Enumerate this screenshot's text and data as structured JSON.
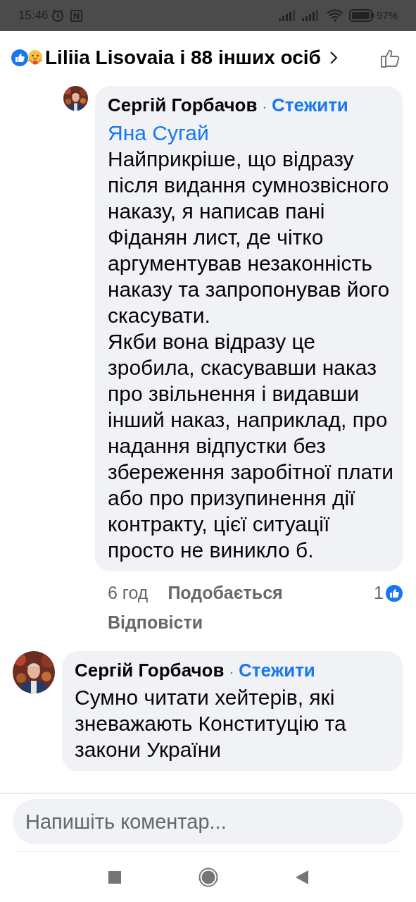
{
  "status_bar": {
    "time": "15:46",
    "battery": "97%"
  },
  "header": {
    "reactions": [
      {
        "kind": "like"
      },
      {
        "kind": "care"
      }
    ],
    "title": "Liliia Lisovaia і 88 інших осіб"
  },
  "comments": [
    {
      "kind": "reply",
      "author": "Сергій Горбачов",
      "separator": "·",
      "follow": "Стежити",
      "mention": "Яна Сугай",
      "paragraphs": [
        "Найприкріше, що відразу після видання сумнозвісного наказу, я написав пані Фіданян лист, де чітко аргументував незаконність наказу та запропонував його скасувати.",
        "Якби вона відразу це зробила, скасувавши наказ про звільнення і видавши інший наказ, наприклад, про надання відпустки без збереження заробітної плати або про призупинення дії контракту, цієї ситуації просто не виникло б."
      ],
      "time": "6 год",
      "like_label": "Подобається",
      "reply_label": "Відповісти",
      "reaction_count": "1"
    },
    {
      "kind": "top",
      "author": "Сергій Горбачов",
      "separator": "·",
      "follow": "Стежити",
      "paragraphs": [
        "Сумно читати хейтерів, які зневажають Конституцію та закони України"
      ]
    }
  ],
  "composer": {
    "placeholder": "Напишіть коментар..."
  }
}
